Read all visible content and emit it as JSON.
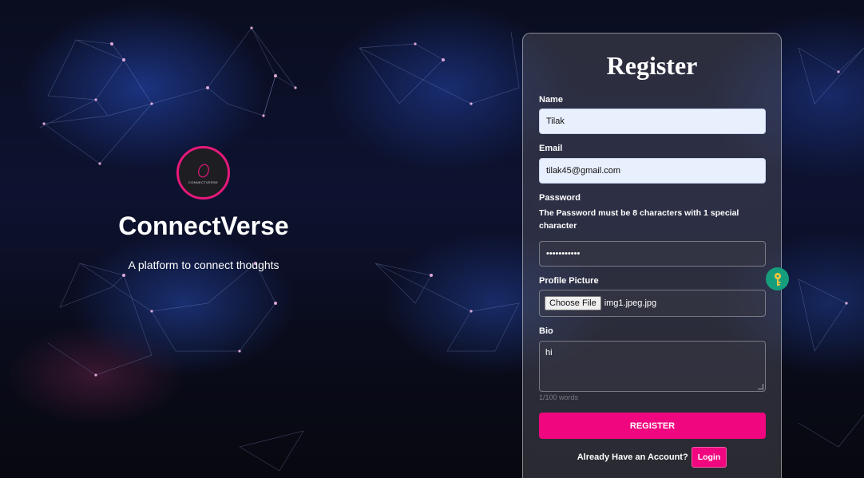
{
  "brand": {
    "logo_text": "CONNECTVERSE",
    "title": "ConnectVerse",
    "tagline": "A platform to connect thoughts"
  },
  "form": {
    "title": "Register",
    "name": {
      "label": "Name",
      "value": "Tilak"
    },
    "email": {
      "label": "Email",
      "value": "tilak45@gmail.com"
    },
    "password": {
      "label": "Password",
      "hint": "The Password must be 8 characters with 1 special character",
      "value": "•••••••••••"
    },
    "profile_picture": {
      "label": "Profile Picture",
      "button": "Choose File",
      "file_name": "img1.jpeg.jpg"
    },
    "bio": {
      "label": "Bio",
      "value": "hi",
      "word_count": "1/100 words"
    },
    "register_button": "REGISTER",
    "login_prompt": "Already Have an Account?",
    "login_button": "Login"
  },
  "icons": {
    "password_manager": "key-icon",
    "logo": "connectverse-logo-icon"
  },
  "colors": {
    "accent": "#f0077f",
    "logo_ring": "#e6197a",
    "key_badge": "#169e7c",
    "input_filled": "#e8effd"
  }
}
